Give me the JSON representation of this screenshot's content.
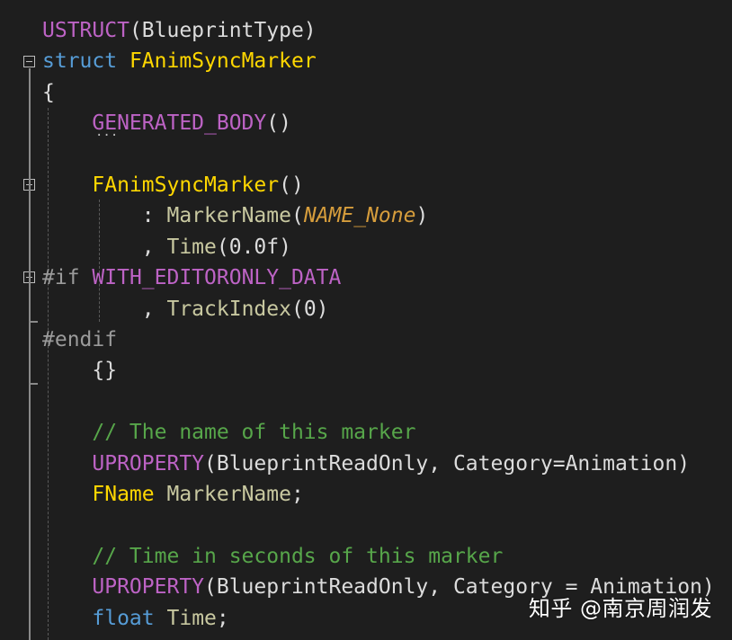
{
  "editor": {
    "lines": [
      {
        "tokens": [
          {
            "t": "USTRUCT",
            "c": "macro"
          },
          {
            "t": "(BlueprintType)",
            "c": "plain"
          }
        ]
      },
      {
        "tokens": [
          {
            "t": "struct",
            "c": "kw"
          },
          {
            "t": " ",
            "c": "plain"
          },
          {
            "t": "FAnimSyncMarker",
            "c": "cls"
          }
        ]
      },
      {
        "tokens": [
          {
            "t": "{",
            "c": "plain"
          }
        ]
      },
      {
        "tokens": [
          {
            "t": "    ",
            "c": "plain"
          },
          {
            "t": "GENERATED_BODY",
            "c": "macro"
          },
          {
            "t": "()",
            "c": "plain"
          }
        ]
      },
      {
        "tokens": []
      },
      {
        "tokens": [
          {
            "t": "    ",
            "c": "plain"
          },
          {
            "t": "FAnimSyncMarker",
            "c": "cls"
          },
          {
            "t": "()",
            "c": "plain"
          }
        ]
      },
      {
        "tokens": [
          {
            "t": "        : ",
            "c": "plain"
          },
          {
            "t": "MarkerName",
            "c": "mem2"
          },
          {
            "t": "(",
            "c": "plain"
          },
          {
            "t": "NAME_None",
            "c": "ital"
          },
          {
            "t": ")",
            "c": "plain"
          }
        ]
      },
      {
        "tokens": [
          {
            "t": "        , ",
            "c": "plain"
          },
          {
            "t": "Time",
            "c": "mem2"
          },
          {
            "t": "(0.0f)",
            "c": "plain"
          }
        ]
      },
      {
        "tokens": [
          {
            "t": "#if",
            "c": "pre"
          },
          {
            "t": " ",
            "c": "plain"
          },
          {
            "t": "WITH_EDITORONLY_DATA",
            "c": "macro"
          }
        ]
      },
      {
        "tokens": [
          {
            "t": "        , ",
            "c": "plain"
          },
          {
            "t": "TrackIndex",
            "c": "mem2"
          },
          {
            "t": "(0)",
            "c": "plain"
          }
        ]
      },
      {
        "tokens": [
          {
            "t": "#endif",
            "c": "pre"
          }
        ]
      },
      {
        "tokens": [
          {
            "t": "    {}",
            "c": "plain"
          }
        ]
      },
      {
        "tokens": []
      },
      {
        "tokens": [
          {
            "t": "    ",
            "c": "plain"
          },
          {
            "t": "// The name of this marker",
            "c": "comment"
          }
        ]
      },
      {
        "tokens": [
          {
            "t": "    ",
            "c": "plain"
          },
          {
            "t": "UPROPERTY",
            "c": "macro"
          },
          {
            "t": "(BlueprintReadOnly, Category=Animation)",
            "c": "plain"
          }
        ]
      },
      {
        "tokens": [
          {
            "t": "    ",
            "c": "plain"
          },
          {
            "t": "FName",
            "c": "cls"
          },
          {
            "t": " ",
            "c": "plain"
          },
          {
            "t": "MarkerName",
            "c": "mem2"
          },
          {
            "t": ";",
            "c": "plain"
          }
        ]
      },
      {
        "tokens": []
      },
      {
        "tokens": [
          {
            "t": "    ",
            "c": "plain"
          },
          {
            "t": "// Time in seconds of this marker",
            "c": "comment"
          }
        ]
      },
      {
        "tokens": [
          {
            "t": "    ",
            "c": "plain"
          },
          {
            "t": "UPROPERTY",
            "c": "macro"
          },
          {
            "t": "(BlueprintReadOnly, Category = Animation)",
            "c": "plain"
          }
        ]
      },
      {
        "tokens": [
          {
            "t": "    ",
            "c": "plain"
          },
          {
            "t": "float",
            "c": "kw"
          },
          {
            "t": " ",
            "c": "plain"
          },
          {
            "t": "Time",
            "c": "mem2"
          },
          {
            "t": ";",
            "c": "plain"
          }
        ]
      }
    ]
  },
  "watermark": {
    "text": "知乎 @南京周润发"
  },
  "colors": {
    "background": "#1e1e1e",
    "macro": "#bd63c5",
    "keyword": "#569cd6",
    "class": "#ffd700",
    "member": "#c8c8a0",
    "comment": "#57a64a",
    "italic_const": "#d69d3c",
    "preprocessor": "#9b9b9b"
  },
  "icons": {
    "fold_collapse": "minus-box-icon",
    "collapsed_region": "ellipsis-icon"
  }
}
